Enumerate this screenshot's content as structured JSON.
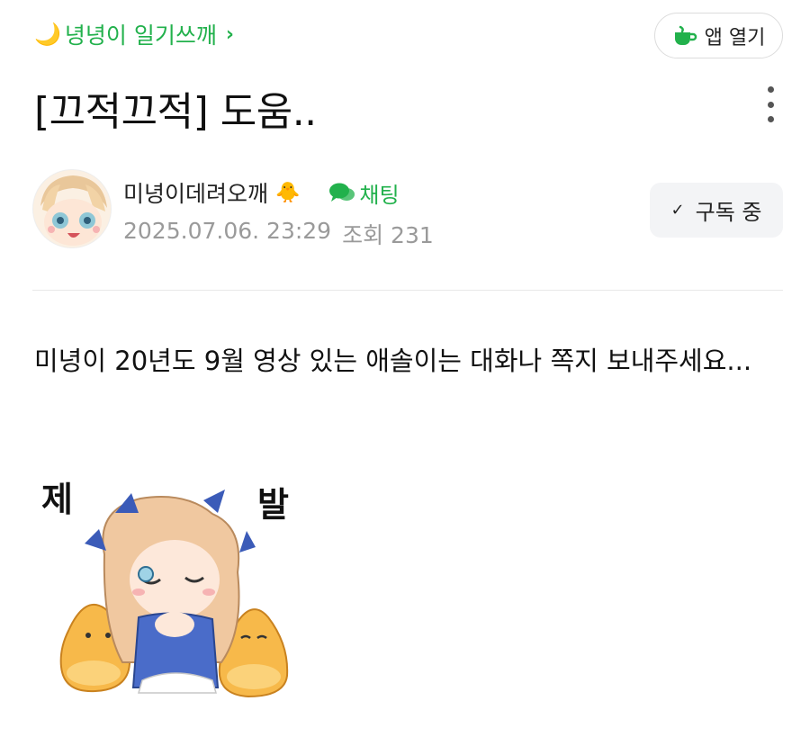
{
  "header": {
    "cafe_icon": "crescent-moon-icon",
    "cafe_name": "녕녕이 일기쓰깨",
    "cafe_chevron": "›",
    "app_button_label": "앱 열기",
    "app_button_icon": "teacup-icon"
  },
  "post": {
    "title": "[끄적끄적] 도움..",
    "author": {
      "name": "미녕이데려오깨",
      "badge": "🐥",
      "chat_label": "채팅",
      "date": "2025.07.06. 23:29",
      "views": "조회 231"
    },
    "subscribe_label": "구독 중",
    "subscribe_icon": "check-icon",
    "content": "미녕이 20년도 9월 영상 있는 애솔이는 대화나 쪽지 보내주세요...",
    "sticker": {
      "text_left": "제",
      "text_right": "발"
    }
  },
  "colors": {
    "brand_green": "#22b14c",
    "meta_gray": "#9a9a9a"
  }
}
